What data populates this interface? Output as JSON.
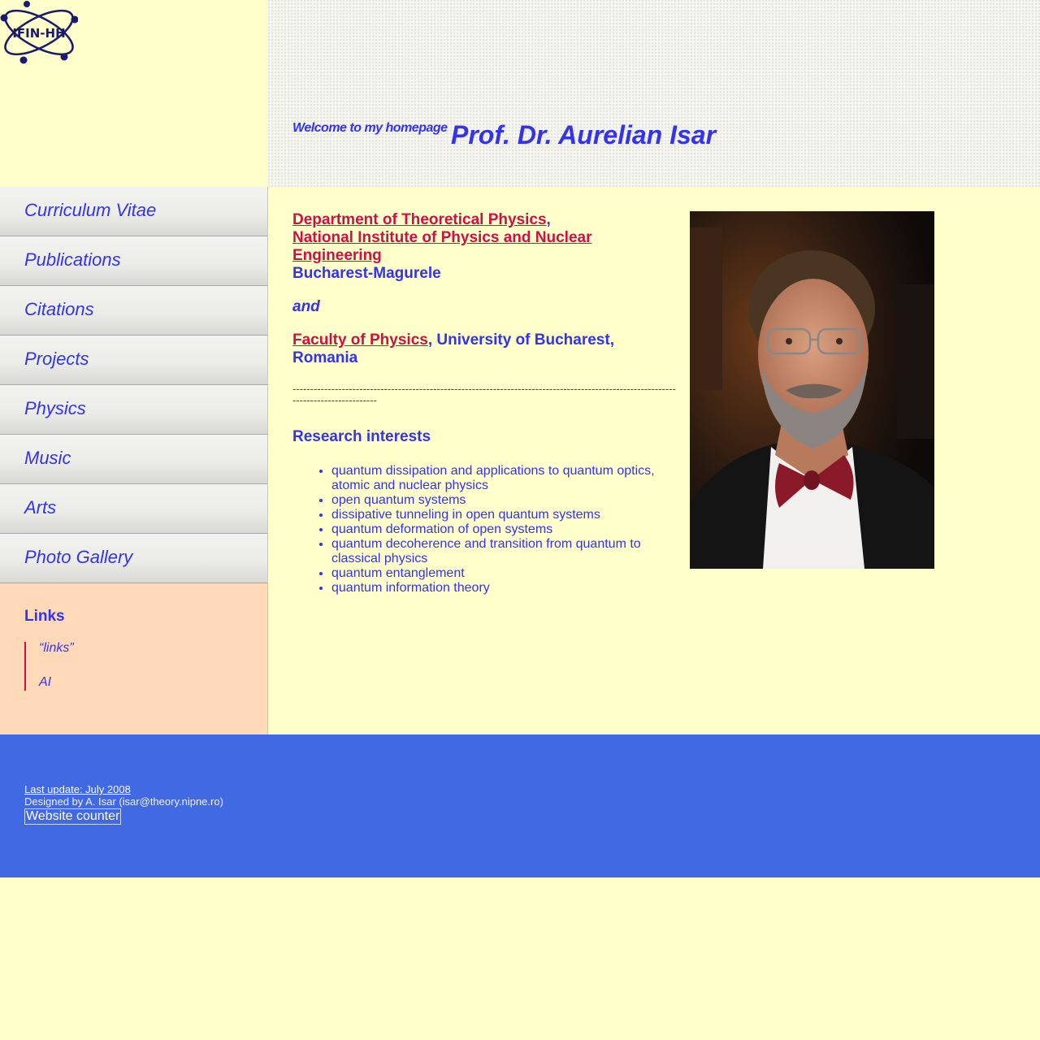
{
  "logo": {
    "text": "IFIN-HH"
  },
  "header": {
    "welcome": "Welcome to my homepage",
    "name": "Prof. Dr. Aurelian Isar"
  },
  "nav": {
    "items": [
      {
        "label": "Curriculum Vitae"
      },
      {
        "label": "Publications"
      },
      {
        "label": "Citations"
      },
      {
        "label": "Projects"
      },
      {
        "label": "Physics"
      },
      {
        "label": "Music"
      },
      {
        "label": "Arts"
      },
      {
        "label": "Photo Gallery"
      }
    ]
  },
  "links": {
    "title": "Links",
    "items": [
      {
        "label": "“links”"
      },
      {
        "label": "AI"
      }
    ]
  },
  "main": {
    "dept_link": "Department of Theoretical Physics",
    "dept_comma": ",",
    "institute_link": "National Institute of Physics and Nuclear Engineering",
    "city": "Bucharest-Magurele",
    "and": "and",
    "faculty_link": "Faculty of Physics",
    "university": ", University of Bucharest, Romania",
    "dashes": "-------------------------------------------------------------------------------------------------------------------------------------",
    "research_title": "Research interests",
    "research": [
      "quantum dissipation and applications to quantum optics, atomic and nuclear physics",
      "open quantum systems",
      "dissipative tunneling in open quantum systems",
      "quantum deformation of open systems",
      "quantum decoherence and transition from quantum to classical physics",
      "quantum entanglement",
      "quantum information theory"
    ]
  },
  "footer": {
    "last_update": "Last update: July 2008",
    "designed_by": "Designed by A. Isar (isar@theory.nipne.ro)",
    "counter_alt": "Website counter"
  },
  "colors": {
    "text_blue": "#3333ee",
    "link_red": "#cc1144",
    "page_bg": "#ffffcc",
    "footer_bg": "#4169e1",
    "links_bg": "#ffd9b8"
  },
  "icons": {
    "logo": "atom-logo-icon"
  }
}
